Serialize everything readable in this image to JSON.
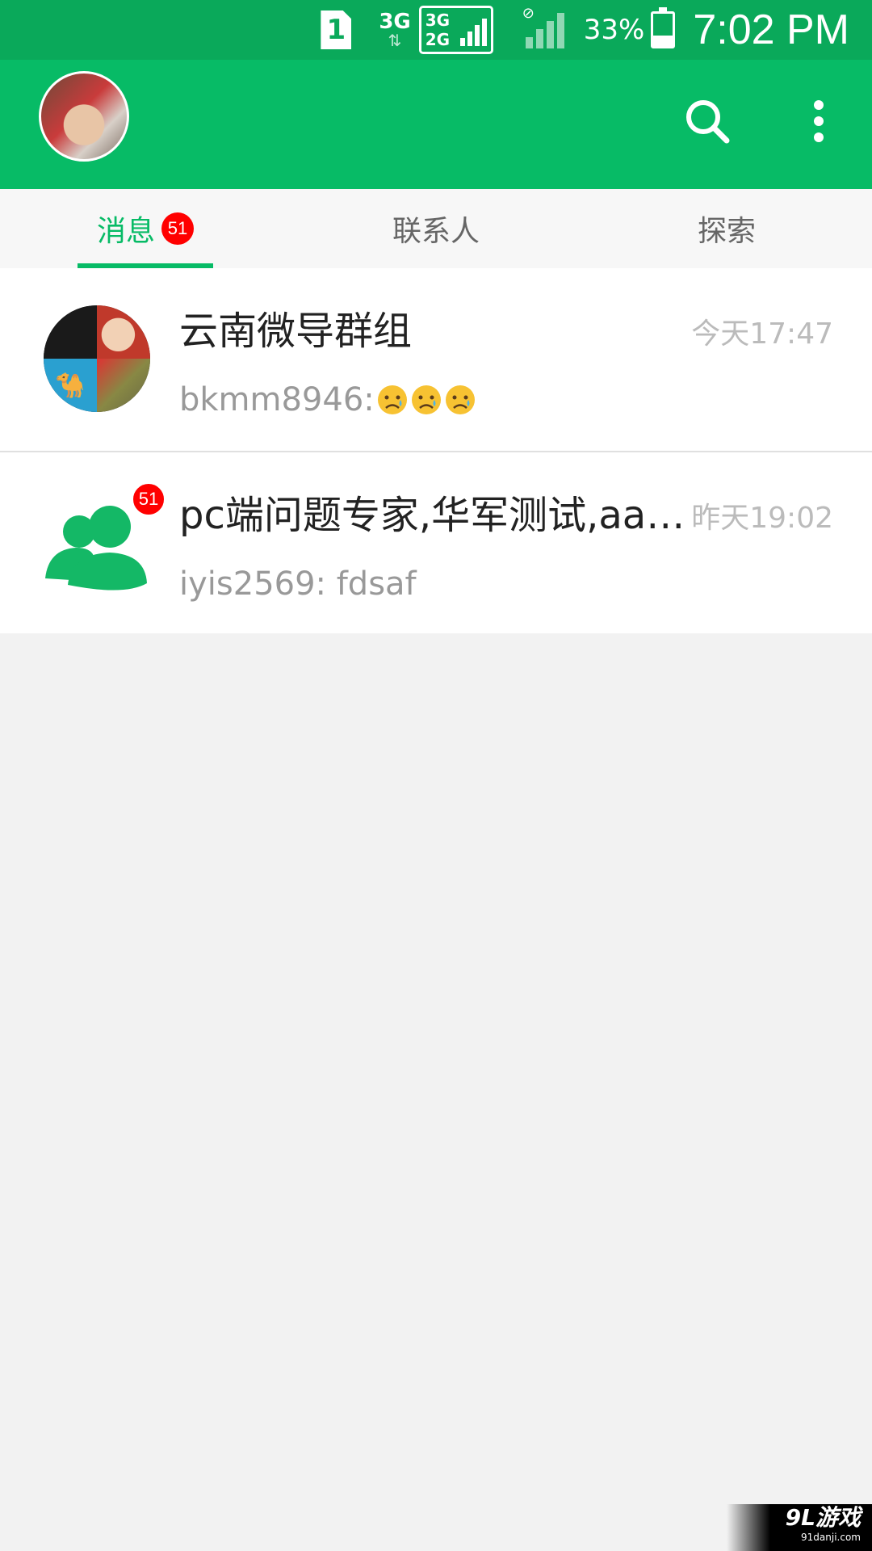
{
  "status_bar": {
    "sim_slot": "1",
    "network": "3G",
    "dual_top": "3G",
    "dual_bottom": "2G",
    "battery_percent": "33%",
    "battery_level": 0.33,
    "time": "7:02 PM"
  },
  "app_bar": {
    "avatar_icon": "profile-avatar",
    "search_icon": "search-icon",
    "more_icon": "more-vertical-icon"
  },
  "tabs": [
    {
      "label": "消息",
      "badge": "51",
      "active": true
    },
    {
      "label": "联系人",
      "active": false
    },
    {
      "label": "探索",
      "active": false
    }
  ],
  "conversations": [
    {
      "title": "云南微导群组",
      "time": "今天17:47",
      "preview": "bkmm8946: ",
      "preview_emoji": [
        "sad-face",
        "sad-face",
        "sad-face"
      ]
    },
    {
      "title": "pc端问题专家,华军测试,aa…",
      "time": "昨天19:02",
      "preview": "iyis2569: fdsaf",
      "badge": "51"
    }
  ],
  "watermark": {
    "brand": "9L游戏",
    "site": "91danji.com"
  },
  "colors": {
    "primary": "#07bb66",
    "status_bar": "#0aa95a",
    "badge": "#ff0000",
    "background": "#f2f2f2"
  }
}
